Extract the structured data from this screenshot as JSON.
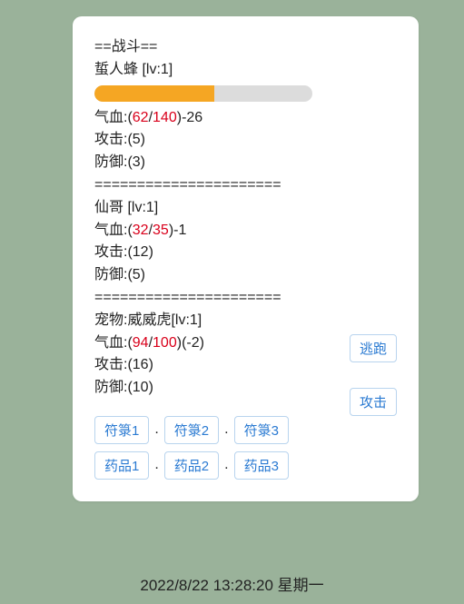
{
  "battle": {
    "header": "==战斗==",
    "enemy": {
      "name_line": "蜇人蜂 [lv:1]",
      "hp_pct": 55,
      "hp_label_prefix": "气血:(",
      "hp_cur": "62",
      "hp_sep": "/",
      "hp_max": "140",
      "hp_label_suffix": ")-26",
      "atk": "攻击:(5)",
      "def": "防御:(3)"
    },
    "sep": "======================",
    "player": {
      "name_line": "仙哥 [lv:1]",
      "hp_label_prefix": "气血:(",
      "hp_cur": "32",
      "hp_sep": "/",
      "hp_max": "35",
      "hp_label_suffix": ")-1",
      "atk": "攻击:(12)",
      "def": "防御:(5)"
    },
    "pet": {
      "name_line": "宠物:威威虎[lv:1]",
      "hp_label_prefix": "气血:(",
      "hp_cur": "94",
      "hp_sep": "/",
      "hp_max": "100",
      "hp_label_suffix": ")(-2)",
      "atk": "攻击:(16)",
      "def": "防御:(10)"
    },
    "actions": {
      "flee": "逃跑",
      "attack": "攻击"
    },
    "talismans": [
      "符箓1",
      "符箓2",
      "符箓3"
    ],
    "potions": [
      "药品1",
      "药品2",
      "药品3"
    ],
    "dot": "."
  },
  "footer": "2022/8/22 13:28:20 星期一"
}
